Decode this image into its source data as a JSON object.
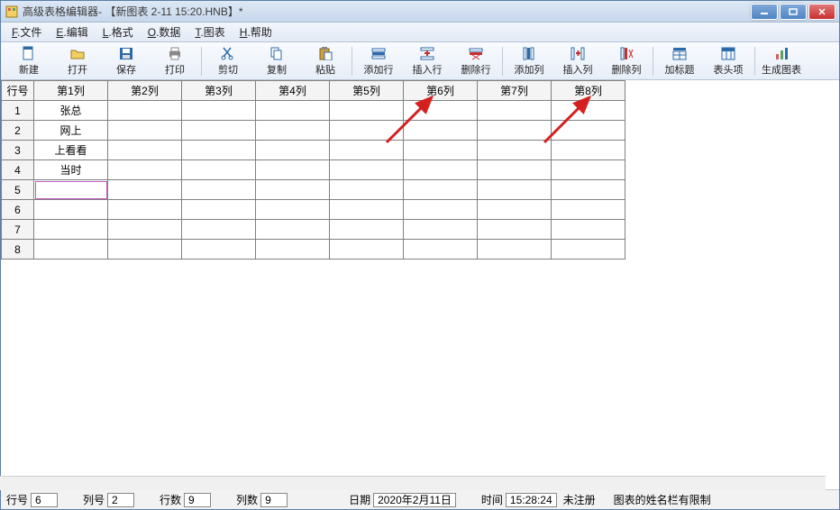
{
  "title": "高级表格编辑器- 【新图表 2-11 15:20.HNB】*",
  "menus": [
    {
      "u": "F",
      "t": ".文件"
    },
    {
      "u": "E",
      "t": ".编辑"
    },
    {
      "u": "L",
      "t": ".格式"
    },
    {
      "u": "O",
      "t": ".数据"
    },
    {
      "u": "T",
      "t": ".图表"
    },
    {
      "u": "H",
      "t": ".帮助"
    }
  ],
  "toolbar": [
    {
      "name": "new",
      "label": "新建",
      "icon": "doc"
    },
    {
      "name": "open",
      "label": "打开",
      "icon": "open"
    },
    {
      "name": "save",
      "label": "保存",
      "icon": "save"
    },
    {
      "name": "print",
      "label": "打印",
      "icon": "print"
    },
    {
      "sep": true
    },
    {
      "name": "cut",
      "label": "剪切",
      "icon": "cut"
    },
    {
      "name": "copy",
      "label": "复制",
      "icon": "copy"
    },
    {
      "name": "paste",
      "label": "粘贴",
      "icon": "paste"
    },
    {
      "sep": true
    },
    {
      "name": "add-row",
      "label": "添加行",
      "icon": "addrow"
    },
    {
      "name": "insert-row",
      "label": "插入行",
      "icon": "insrow"
    },
    {
      "name": "delete-row",
      "label": "删除行",
      "icon": "delrow"
    },
    {
      "sep": true
    },
    {
      "name": "add-col",
      "label": "添加列",
      "icon": "addcol"
    },
    {
      "name": "insert-col",
      "label": "插入列",
      "icon": "inscol"
    },
    {
      "name": "delete-col",
      "label": "删除列",
      "icon": "delcol"
    },
    {
      "sep": true
    },
    {
      "name": "add-title",
      "label": "加标题",
      "icon": "addtitle"
    },
    {
      "name": "header-item",
      "label": "表头项",
      "icon": "header"
    },
    {
      "sep": true
    },
    {
      "name": "gen-chart",
      "label": "生成图表",
      "icon": "chart"
    }
  ],
  "headers": [
    "行号",
    "第1列",
    "第2列",
    "第3列",
    "第4列",
    "第5列",
    "第6列",
    "第7列",
    "第8列"
  ],
  "rows": [
    {
      "n": "1",
      "cells": [
        "张总",
        "",
        "",
        "",
        "",
        "",
        "",
        ""
      ]
    },
    {
      "n": "2",
      "cells": [
        "网上",
        "",
        "",
        "",
        "",
        "",
        "",
        ""
      ]
    },
    {
      "n": "3",
      "cells": [
        "上看看",
        "",
        "",
        "",
        "",
        "",
        "",
        ""
      ]
    },
    {
      "n": "4",
      "cells": [
        "当时",
        "",
        "",
        "",
        "",
        "",
        "",
        ""
      ]
    },
    {
      "n": "5",
      "cells": [
        "",
        "",
        "",
        "",
        "",
        "",
        "",
        ""
      ]
    },
    {
      "n": "6",
      "cells": [
        "",
        "",
        "",
        "",
        "",
        "",
        "",
        ""
      ]
    },
    {
      "n": "7",
      "cells": [
        "",
        "",
        "",
        "",
        "",
        "",
        "",
        ""
      ]
    },
    {
      "n": "8",
      "cells": [
        "",
        "",
        "",
        "",
        "",
        "",
        "",
        ""
      ]
    }
  ],
  "selectedRow": 5,
  "selectedCol": 1,
  "status": {
    "rowNumLabel": "行号",
    "rowNum": "6",
    "colNumLabel": "列号",
    "colNum": "2",
    "rowCountLabel": "行数",
    "rowCount": "9",
    "colCountLabel": "列数",
    "colCount": "9",
    "dateLabel": "日期",
    "date": "2020年2月11日",
    "timeLabel": "时间",
    "time": "15:28:24",
    "registered": "未注册",
    "tip": "图表的姓名栏有限制"
  },
  "colors": {
    "arrow": "#d62020",
    "toolbarIcon": "#2d6aa8"
  }
}
